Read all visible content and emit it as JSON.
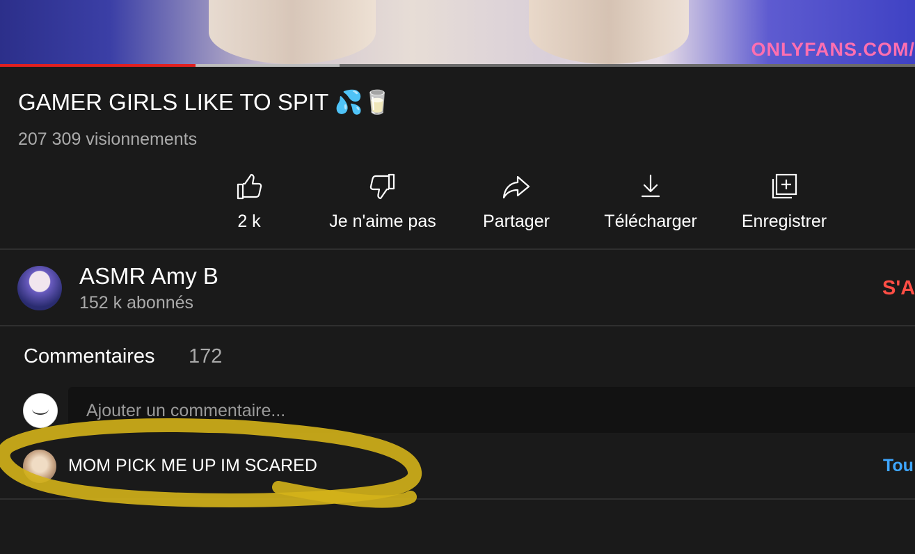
{
  "video": {
    "watermark": "ONLYFANS.COM/",
    "progress_played": 0.214,
    "progress_buffered": 0.371
  },
  "title": "GAMER GIRLS LIKE TO SPIT 💦🥛",
  "views": "207 309 visionnements",
  "actions": {
    "like": {
      "label": "2 k",
      "icon": "thumbs-up-icon"
    },
    "dislike": {
      "label": "Je n'aime pas",
      "icon": "thumbs-down-icon"
    },
    "share": {
      "label": "Partager",
      "icon": "share-arrow-icon"
    },
    "download": {
      "label": "Télécharger",
      "icon": "download-icon"
    },
    "save": {
      "label": "Enregistrer",
      "icon": "add-to-playlist-icon"
    }
  },
  "channel": {
    "name": "ASMR Amy B",
    "subscribers": "152 k abonnés",
    "subscribe_label": "S'A"
  },
  "comments": {
    "heading": "Commentaires",
    "count": "172",
    "input_placeholder": "Ajouter un commentaire...",
    "top_comment": "MOM PICK ME UP IM SCARED",
    "see_all_label": "Tou"
  },
  "colors": {
    "background": "#1a1a1a",
    "progress_played": "#e02020",
    "subscribe": "#ff4e45",
    "link": "#3ea6ff",
    "highlight": "#d4b21a"
  }
}
